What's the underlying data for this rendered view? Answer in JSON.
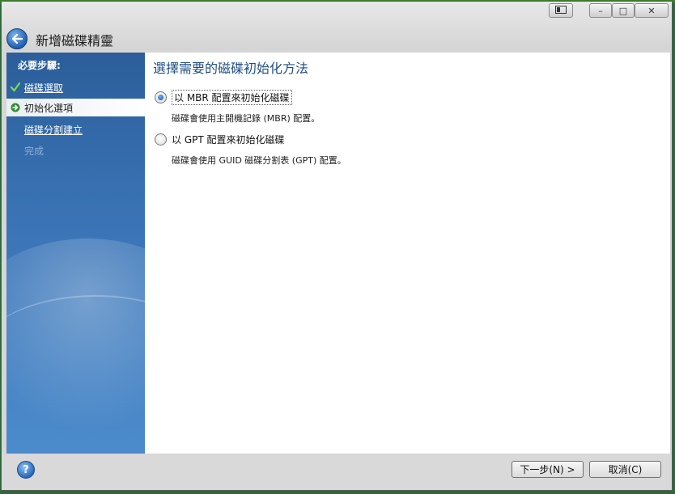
{
  "window": {
    "title": "新增磁碟精靈"
  },
  "titlebar_controls": {
    "extra_icon": "window-switch-icon",
    "minimize_glyph": "–",
    "maximize_glyph": "□",
    "close_glyph": "✕"
  },
  "sidebar": {
    "header": "必要步驟:",
    "steps": [
      {
        "label": "磁碟選取",
        "state": "done"
      },
      {
        "label": "初始化選項",
        "state": "current"
      },
      {
        "label": "磁碟分割建立",
        "state": "pending"
      },
      {
        "label": "完成",
        "state": "disabled"
      }
    ]
  },
  "content": {
    "title": "選擇需要的磁碟初始化方法",
    "options": [
      {
        "label": "以 MBR 配置來初始化磁碟",
        "description": "磁碟會使用主開機記錄 (MBR) 配置。",
        "selected": true
      },
      {
        "label": "以 GPT 配置來初始化磁碟",
        "description": "磁碟會使用 GUID 磁碟分割表 (GPT) 配置。",
        "selected": false
      }
    ]
  },
  "footer": {
    "help_glyph": "?",
    "next_label": "下一步(N) >",
    "cancel_label": "取消(C)"
  },
  "colors": {
    "sidebar_blue": "#3a73b5",
    "title_blue": "#1f4e86",
    "background_green": "#2a6a3a"
  }
}
